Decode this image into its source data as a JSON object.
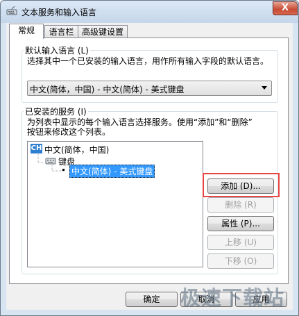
{
  "window": {
    "title": "文本服务和输入语言",
    "close_label": "X"
  },
  "tabs": [
    {
      "label": "常规",
      "active": true
    },
    {
      "label": "语言栏",
      "active": false
    },
    {
      "label": "高级键设置",
      "active": false
    }
  ],
  "default_language": {
    "group_label": "默认输入语言 (L)",
    "description": "选择其中一个已安装的输入语言，用作所有输入字段的默认语言。",
    "selected": "中文(简体，中国) - 中文(简体) - 美式键盘"
  },
  "installed_services": {
    "group_label": "已安装的服务 (I)",
    "description_line1": "为列表中显示的每个输入语言选择服务。使用“添加”和“删除”",
    "description_line2": "按钮来修改这个列表。",
    "tree": {
      "language_badge": "CH",
      "language": "中文(简体，中国)",
      "category": "键盘",
      "service": "中文(简体) - 美式键盘"
    },
    "buttons": {
      "add": "添加 (D)...",
      "remove": "删除 (R)",
      "properties": "属性 (P)...",
      "move_up": "上移 (U)",
      "move_down": "下移 (O)"
    }
  },
  "footer": {
    "ok": "确定",
    "cancel": "取消",
    "apply": "应用"
  },
  "watermark": "极速下载站",
  "colors": {
    "selection": "#3399ff",
    "highlight_box": "#e84545"
  }
}
